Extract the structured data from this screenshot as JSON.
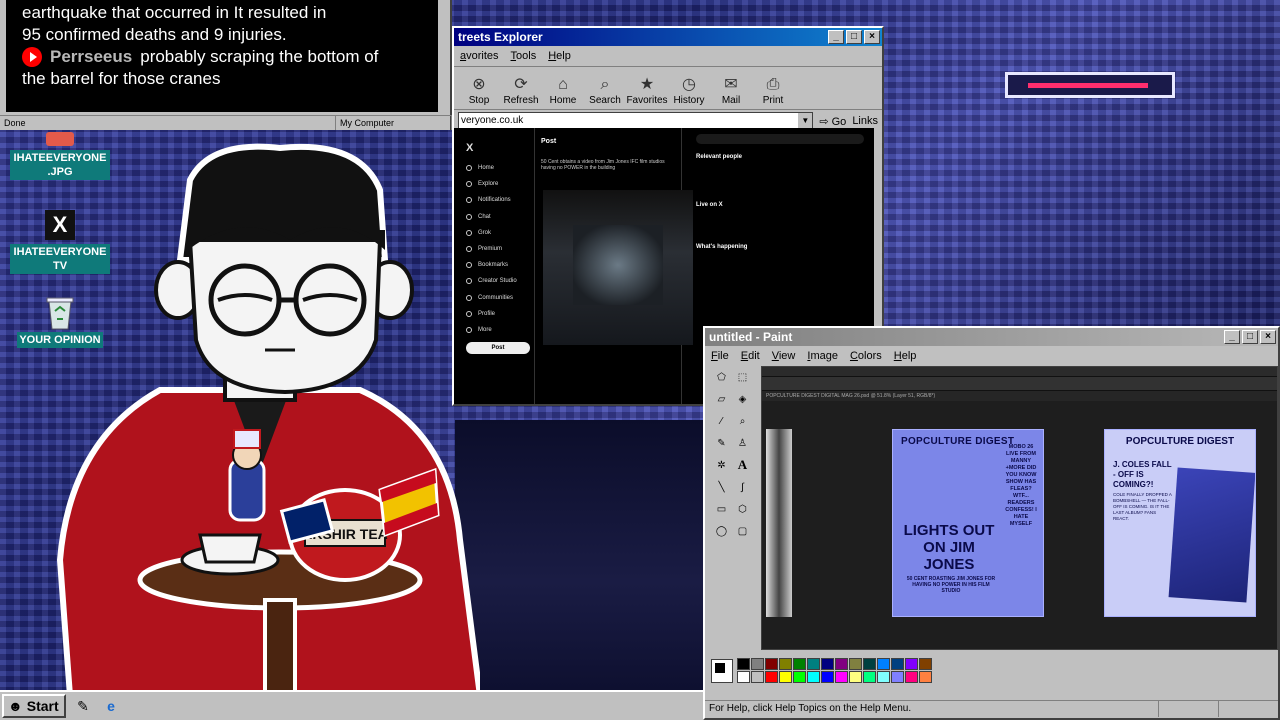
{
  "caption": {
    "line1": "earthquake that occurred in  It resulted in",
    "line2": "95 confirmed deaths and 9 injuries.",
    "author": "Perrseeus",
    "comment_part1": "probably scraping the bottom of",
    "comment_part2": "the barrel for those cranes"
  },
  "caption_status": {
    "done": "Done",
    "zone": "My Computer"
  },
  "ie": {
    "title": "treets Explorer",
    "menus": [
      "avorites",
      "Tools",
      "Help"
    ],
    "toolbar": [
      {
        "label": "Stop",
        "icon": "stop-icon",
        "glyph": "⊗"
      },
      {
        "label": "Refresh",
        "icon": "refresh-icon",
        "glyph": "⟳"
      },
      {
        "label": "Home",
        "icon": "home-icon",
        "glyph": "⌂"
      },
      {
        "label": "Search",
        "icon": "search-icon",
        "glyph": "⌕"
      },
      {
        "label": "Favorites",
        "icon": "favorites-icon",
        "glyph": "★"
      },
      {
        "label": "History",
        "icon": "history-icon",
        "glyph": "◷"
      },
      {
        "label": "Mail",
        "icon": "mail-icon",
        "glyph": "✉"
      },
      {
        "label": "Print",
        "icon": "print-icon",
        "glyph": "⎙"
      }
    ],
    "address": "veryone.co.uk",
    "go": "Go",
    "links": "Links"
  },
  "x_page": {
    "logo": "X",
    "nav": [
      "Home",
      "Explore",
      "Notifications",
      "Chat",
      "Grok",
      "Premium",
      "Bookmarks",
      "Creator Studio",
      "Communities",
      "Profile",
      "More"
    ],
    "post_button": "Post",
    "post_header": "Post",
    "post_text": "50 Cent obtains a video from Jim Jones IFC film studios having no POWER in the building",
    "relevant": "Relevant people",
    "live": "Live on X",
    "happening": "What's happening"
  },
  "paint": {
    "title": "untitled - Paint",
    "menus": [
      "File",
      "Edit",
      "View",
      "Image",
      "Colors",
      "Help"
    ],
    "status": "For Help, click Help Topics on the Help Menu.",
    "ps_tabs": "POPCULTURE DIGEST DIGITAL MAG 26.psd @ 51.8% (Layer 51, RGB/8*)",
    "cover": {
      "head": "POPCULTURE DIGEST",
      "big": "LIGHTS OUT ON JIM JONES",
      "small": "50 CENT ROASTING JIM JONES FOR HAVING NO POWER IN HIS FILM STUDIO",
      "side": "MOBO 26 LIVE FROM MANNY +MORE  DID YOU KNOW SHOW HAS FLEAS?  WTF... READERS CONFESS!  I HATE MYSELF"
    },
    "second": {
      "head": "POPCULTURE DIGEST",
      "q": "J. COLES FALL - OFF IS COMING?!",
      "body": "COLE FINALLY DROPPED A BOMBSHELL — THE FALL-OFF IS COMING. IS IT THE LAST ALBUM? FANS REACT."
    },
    "palette": [
      "#000000",
      "#808080",
      "#800000",
      "#808000",
      "#008000",
      "#008080",
      "#000080",
      "#800080",
      "#808040",
      "#004040",
      "#0080ff",
      "#004080",
      "#8000ff",
      "#804000",
      "#ffffff",
      "#c0c0c0",
      "#ff0000",
      "#ffff00",
      "#00ff00",
      "#00ffff",
      "#0000ff",
      "#ff00ff",
      "#ffff80",
      "#00ff80",
      "#80ffff",
      "#8080ff",
      "#ff0080",
      "#ff8040"
    ]
  },
  "desktop_icons": [
    {
      "label": "IHATEEVERYONE .JPG",
      "icon": "image-file-icon"
    },
    {
      "label": "IHATEEVERYONE TV",
      "icon": "x-logo-icon"
    },
    {
      "label": "YOUR OPINION",
      "icon": "recycle-bin-icon"
    }
  ],
  "taskbar": {
    "start": "Start"
  },
  "colors": {
    "titlebar": "#000080",
    "desktop_label": "#0f7a7a",
    "jacket": "#b0121c"
  }
}
